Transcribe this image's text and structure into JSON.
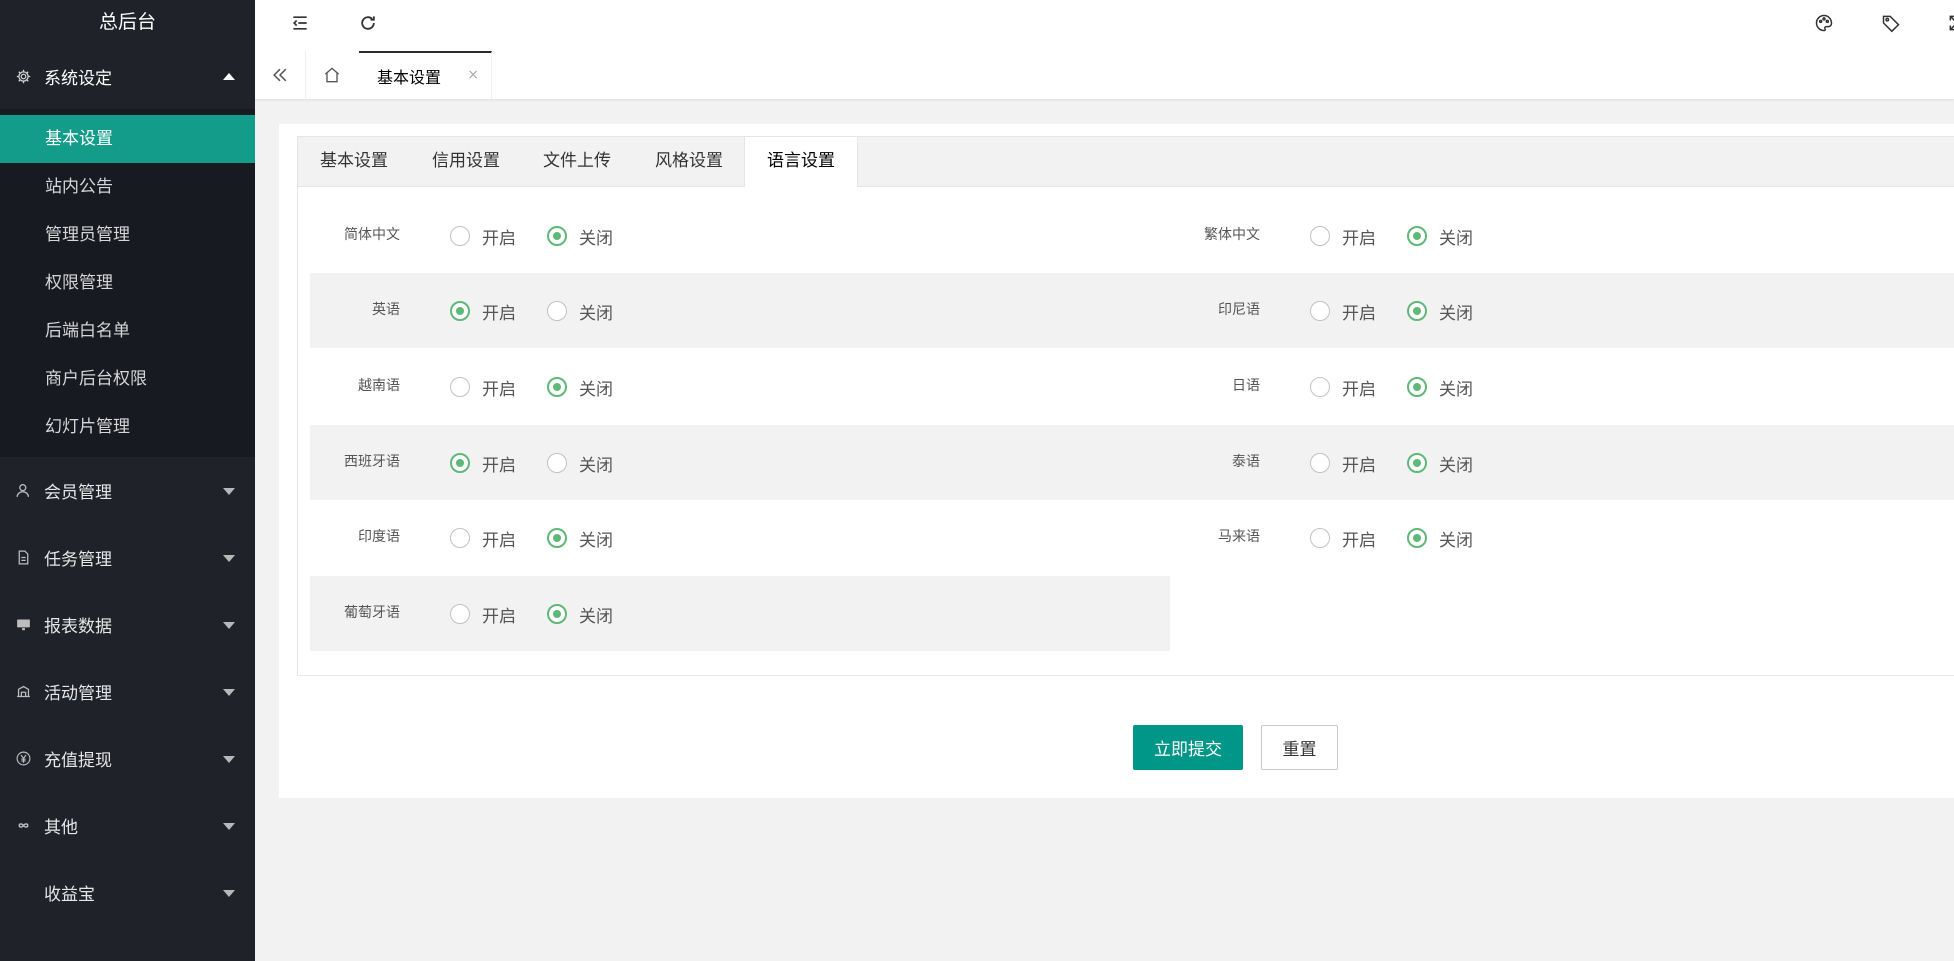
{
  "app": {
    "title": "总后台"
  },
  "sidebar": {
    "groups": [
      {
        "label": "系统设定",
        "icon": "gear-icon",
        "open": true,
        "items": [
          "基本设置",
          "站内公告",
          "管理员管理",
          "权限管理",
          "后端白名单",
          "商户后台权限",
          "幻灯片管理"
        ],
        "active_item": "基本设置"
      },
      {
        "label": "会员管理",
        "icon": "user-icon"
      },
      {
        "label": "任务管理",
        "icon": "document-icon"
      },
      {
        "label": "报表数据",
        "icon": "monitor-icon"
      },
      {
        "label": "活动管理",
        "icon": "stand-icon"
      },
      {
        "label": "充值提现",
        "icon": "yen-icon"
      },
      {
        "label": "其他",
        "icon": "infinity-icon"
      },
      {
        "label": "收益宝",
        "icon": ""
      }
    ]
  },
  "header": {
    "icons": [
      "shrink-menu-icon",
      "refresh-icon",
      "palette-icon",
      "tag-icon",
      "fullscreen-icon"
    ]
  },
  "page_tabs": {
    "icons": [
      "double-chevron-left-icon",
      "home-icon"
    ],
    "current": {
      "label": "基本设置",
      "close": "×"
    }
  },
  "settings_tabs": [
    "基本设置",
    "信用设置",
    "文件上传",
    "风格设置",
    "语言设置"
  ],
  "active_settings_tab": "语言设置",
  "radio_labels": {
    "on": "开启",
    "off": "关闭"
  },
  "languages": [
    {
      "name": "简体中文",
      "enabled": false
    },
    {
      "name": "繁体中文",
      "enabled": false
    },
    {
      "name": "英语",
      "enabled": true
    },
    {
      "name": "印尼语",
      "enabled": false
    },
    {
      "name": "越南语",
      "enabled": false
    },
    {
      "name": "日语",
      "enabled": false
    },
    {
      "name": "西班牙语",
      "enabled": true
    },
    {
      "name": "泰语",
      "enabled": false
    },
    {
      "name": "印度语",
      "enabled": false
    },
    {
      "name": "马来语",
      "enabled": false
    },
    {
      "name": "葡萄牙语",
      "enabled": false
    }
  ],
  "actions": {
    "submit": "立即提交",
    "reset": "重置"
  },
  "colors": {
    "accent": "#009688",
    "radio_on": "#5fb878",
    "sidebar_bg": "#20222a",
    "active_item_bg": "#139c89"
  }
}
